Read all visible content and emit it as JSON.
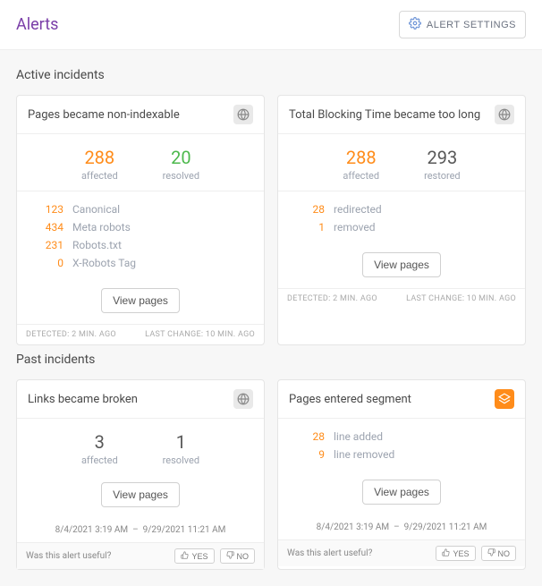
{
  "header": {
    "title": "Alerts",
    "settings_label": "ALERT SETTINGS"
  },
  "sections": {
    "active": {
      "title": "Active incidents"
    },
    "past": {
      "title": "Past incidents"
    }
  },
  "cards": {
    "nonindexable": {
      "title": "Pages became non-indexable",
      "affected": "288",
      "affected_label": "affected",
      "resolved": "20",
      "resolved_label": "resolved",
      "lines": [
        {
          "num": "123",
          "label": "Canonical"
        },
        {
          "num": "434",
          "label": "Meta robots"
        },
        {
          "num": "231",
          "label": "Robots.txt"
        },
        {
          "num": "0",
          "label": "X-Robots Tag"
        }
      ],
      "view": "View pages",
      "detected": "DETECTED: 2 MIN. AGO",
      "last_change": "LAST CHANGE: 10 MIN. AGO"
    },
    "tbt": {
      "title": "Total Blocking Time became too long",
      "affected": "288",
      "affected_label": "affected",
      "restored": "293",
      "restored_label": "restored",
      "lines": [
        {
          "num": "28",
          "label": "redirected"
        },
        {
          "num": "1",
          "label": "removed"
        }
      ],
      "view": "View pages",
      "detected": "DETECTED: 2 MIN. AGO",
      "last_change": "LAST CHANGE: 10 MIN. AGO"
    },
    "broken": {
      "title": "Links became broken",
      "affected": "3",
      "affected_label": "affected",
      "resolved": "1",
      "resolved_label": "resolved",
      "view": "View pages",
      "date_from": "8/4/2021 3:19 AM",
      "date_to": "9/29/2021 11:21 AM",
      "useful": "Was this alert useful?",
      "yes": "YES",
      "no": "NO"
    },
    "segment": {
      "title": "Pages entered segment",
      "lines": [
        {
          "num": "28",
          "label": "line added"
        },
        {
          "num": "9",
          "label": "line removed"
        }
      ],
      "view": "View pages",
      "date_from": "8/4/2021 3:19 AM",
      "date_to": "9/29/2021 11:21 AM",
      "useful": "Was this alert useful?",
      "yes": "YES",
      "no": "NO"
    }
  }
}
